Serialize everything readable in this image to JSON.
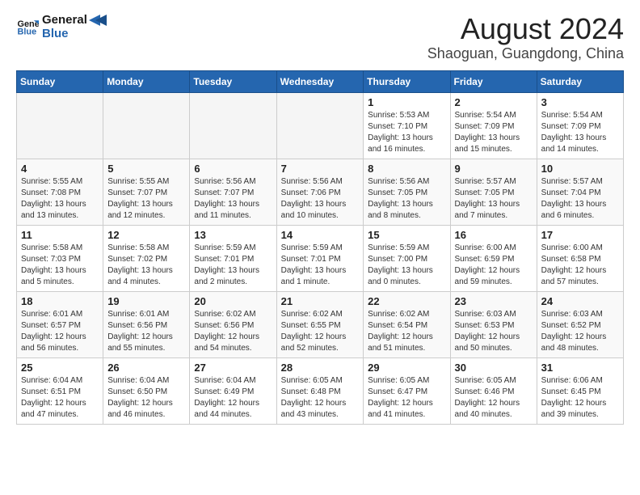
{
  "header": {
    "logo_line1": "General",
    "logo_line2": "Blue",
    "main_title": "August 2024",
    "subtitle": "Shaoguan, Guangdong, China"
  },
  "weekdays": [
    "Sunday",
    "Monday",
    "Tuesday",
    "Wednesday",
    "Thursday",
    "Friday",
    "Saturday"
  ],
  "weeks": [
    [
      {
        "day": "",
        "info": ""
      },
      {
        "day": "",
        "info": ""
      },
      {
        "day": "",
        "info": ""
      },
      {
        "day": "",
        "info": ""
      },
      {
        "day": "1",
        "info": "Sunrise: 5:53 AM\nSunset: 7:10 PM\nDaylight: 13 hours\nand 16 minutes."
      },
      {
        "day": "2",
        "info": "Sunrise: 5:54 AM\nSunset: 7:09 PM\nDaylight: 13 hours\nand 15 minutes."
      },
      {
        "day": "3",
        "info": "Sunrise: 5:54 AM\nSunset: 7:09 PM\nDaylight: 13 hours\nand 14 minutes."
      }
    ],
    [
      {
        "day": "4",
        "info": "Sunrise: 5:55 AM\nSunset: 7:08 PM\nDaylight: 13 hours\nand 13 minutes."
      },
      {
        "day": "5",
        "info": "Sunrise: 5:55 AM\nSunset: 7:07 PM\nDaylight: 13 hours\nand 12 minutes."
      },
      {
        "day": "6",
        "info": "Sunrise: 5:56 AM\nSunset: 7:07 PM\nDaylight: 13 hours\nand 11 minutes."
      },
      {
        "day": "7",
        "info": "Sunrise: 5:56 AM\nSunset: 7:06 PM\nDaylight: 13 hours\nand 10 minutes."
      },
      {
        "day": "8",
        "info": "Sunrise: 5:56 AM\nSunset: 7:05 PM\nDaylight: 13 hours\nand 8 minutes."
      },
      {
        "day": "9",
        "info": "Sunrise: 5:57 AM\nSunset: 7:05 PM\nDaylight: 13 hours\nand 7 minutes."
      },
      {
        "day": "10",
        "info": "Sunrise: 5:57 AM\nSunset: 7:04 PM\nDaylight: 13 hours\nand 6 minutes."
      }
    ],
    [
      {
        "day": "11",
        "info": "Sunrise: 5:58 AM\nSunset: 7:03 PM\nDaylight: 13 hours\nand 5 minutes."
      },
      {
        "day": "12",
        "info": "Sunrise: 5:58 AM\nSunset: 7:02 PM\nDaylight: 13 hours\nand 4 minutes."
      },
      {
        "day": "13",
        "info": "Sunrise: 5:59 AM\nSunset: 7:01 PM\nDaylight: 13 hours\nand 2 minutes."
      },
      {
        "day": "14",
        "info": "Sunrise: 5:59 AM\nSunset: 7:01 PM\nDaylight: 13 hours\nand 1 minute."
      },
      {
        "day": "15",
        "info": "Sunrise: 5:59 AM\nSunset: 7:00 PM\nDaylight: 13 hours\nand 0 minutes."
      },
      {
        "day": "16",
        "info": "Sunrise: 6:00 AM\nSunset: 6:59 PM\nDaylight: 12 hours\nand 59 minutes."
      },
      {
        "day": "17",
        "info": "Sunrise: 6:00 AM\nSunset: 6:58 PM\nDaylight: 12 hours\nand 57 minutes."
      }
    ],
    [
      {
        "day": "18",
        "info": "Sunrise: 6:01 AM\nSunset: 6:57 PM\nDaylight: 12 hours\nand 56 minutes."
      },
      {
        "day": "19",
        "info": "Sunrise: 6:01 AM\nSunset: 6:56 PM\nDaylight: 12 hours\nand 55 minutes."
      },
      {
        "day": "20",
        "info": "Sunrise: 6:02 AM\nSunset: 6:56 PM\nDaylight: 12 hours\nand 54 minutes."
      },
      {
        "day": "21",
        "info": "Sunrise: 6:02 AM\nSunset: 6:55 PM\nDaylight: 12 hours\nand 52 minutes."
      },
      {
        "day": "22",
        "info": "Sunrise: 6:02 AM\nSunset: 6:54 PM\nDaylight: 12 hours\nand 51 minutes."
      },
      {
        "day": "23",
        "info": "Sunrise: 6:03 AM\nSunset: 6:53 PM\nDaylight: 12 hours\nand 50 minutes."
      },
      {
        "day": "24",
        "info": "Sunrise: 6:03 AM\nSunset: 6:52 PM\nDaylight: 12 hours\nand 48 minutes."
      }
    ],
    [
      {
        "day": "25",
        "info": "Sunrise: 6:04 AM\nSunset: 6:51 PM\nDaylight: 12 hours\nand 47 minutes."
      },
      {
        "day": "26",
        "info": "Sunrise: 6:04 AM\nSunset: 6:50 PM\nDaylight: 12 hours\nand 46 minutes."
      },
      {
        "day": "27",
        "info": "Sunrise: 6:04 AM\nSunset: 6:49 PM\nDaylight: 12 hours\nand 44 minutes."
      },
      {
        "day": "28",
        "info": "Sunrise: 6:05 AM\nSunset: 6:48 PM\nDaylight: 12 hours\nand 43 minutes."
      },
      {
        "day": "29",
        "info": "Sunrise: 6:05 AM\nSunset: 6:47 PM\nDaylight: 12 hours\nand 41 minutes."
      },
      {
        "day": "30",
        "info": "Sunrise: 6:05 AM\nSunset: 6:46 PM\nDaylight: 12 hours\nand 40 minutes."
      },
      {
        "day": "31",
        "info": "Sunrise: 6:06 AM\nSunset: 6:45 PM\nDaylight: 12 hours\nand 39 minutes."
      }
    ]
  ]
}
